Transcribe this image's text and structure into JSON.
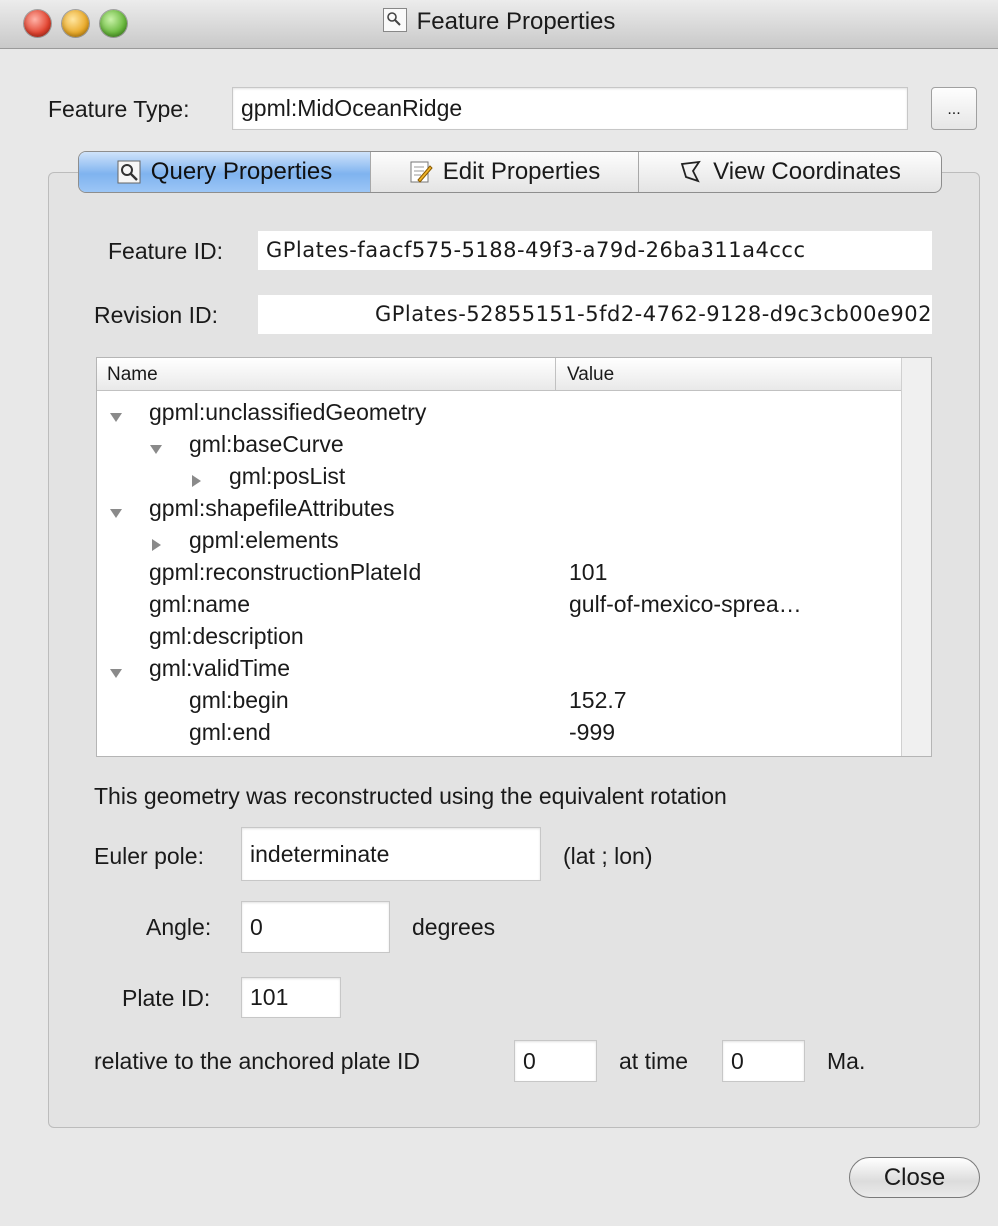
{
  "window": {
    "title": "Feature Properties"
  },
  "feature_type": {
    "label": "Feature Type:",
    "value": "gpml:MidOceanRidge",
    "browse_label": "..."
  },
  "tabs": [
    {
      "label": "Query Properties",
      "icon": "magnifier-icon",
      "active": true
    },
    {
      "label": "Edit Properties",
      "icon": "edit-pencil-icon",
      "active": false
    },
    {
      "label": "View Coordinates",
      "icon": "polygon-icon",
      "active": false
    }
  ],
  "feature_id": {
    "label": "Feature ID:",
    "value": "GPlates-faacf575-5188-49f3-a79d-26ba311a4ccc"
  },
  "revision_id": {
    "label": "Revision ID:",
    "value": "GPlates-52855151-5fd2-4762-9128-d9c3cb00e902"
  },
  "tree": {
    "columns": [
      "Name",
      "Value"
    ],
    "rows": [
      {
        "name": "gpml:unclassifiedGeometry",
        "value": "",
        "level": 0,
        "expander": "expanded"
      },
      {
        "name": "gml:baseCurve",
        "value": "",
        "level": 1,
        "expander": "expanded"
      },
      {
        "name": "gml:posList",
        "value": "",
        "level": 2,
        "expander": "collapsed"
      },
      {
        "name": "gpml:shapefileAttributes",
        "value": "",
        "level": 0,
        "expander": "expanded"
      },
      {
        "name": "gpml:elements",
        "value": "",
        "level": 1,
        "expander": "collapsed"
      },
      {
        "name": "gpml:reconstructionPlateId",
        "value": "101",
        "level": 0,
        "expander": "none"
      },
      {
        "name": "gml:name",
        "value": "gulf-of-mexico-sprea…",
        "level": 0,
        "expander": "none"
      },
      {
        "name": "gml:description",
        "value": "",
        "level": 0,
        "expander": "none"
      },
      {
        "name": "gml:validTime",
        "value": "",
        "level": 0,
        "expander": "expanded"
      },
      {
        "name": "gml:begin",
        "value": "152.7",
        "level": 1,
        "expander": "none"
      },
      {
        "name": "gml:end",
        "value": "-999",
        "level": 1,
        "expander": "none"
      }
    ]
  },
  "rotation": {
    "info_text": "This geometry was reconstructed using the equivalent rotation",
    "euler_pole_label": "Euler pole:",
    "euler_pole_value": "indeterminate",
    "euler_pole_units": "(lat ; lon)",
    "angle_label": "Angle:",
    "angle_value": "0",
    "angle_units": "degrees",
    "plate_id_label": "Plate ID:",
    "plate_id_value": "101",
    "relative_label": "relative to the anchored plate ID",
    "anchored_plate_value": "0",
    "at_time_label": "at time",
    "time_value": "0",
    "time_units": "Ma."
  },
  "buttons": {
    "close_label": "Close"
  }
}
